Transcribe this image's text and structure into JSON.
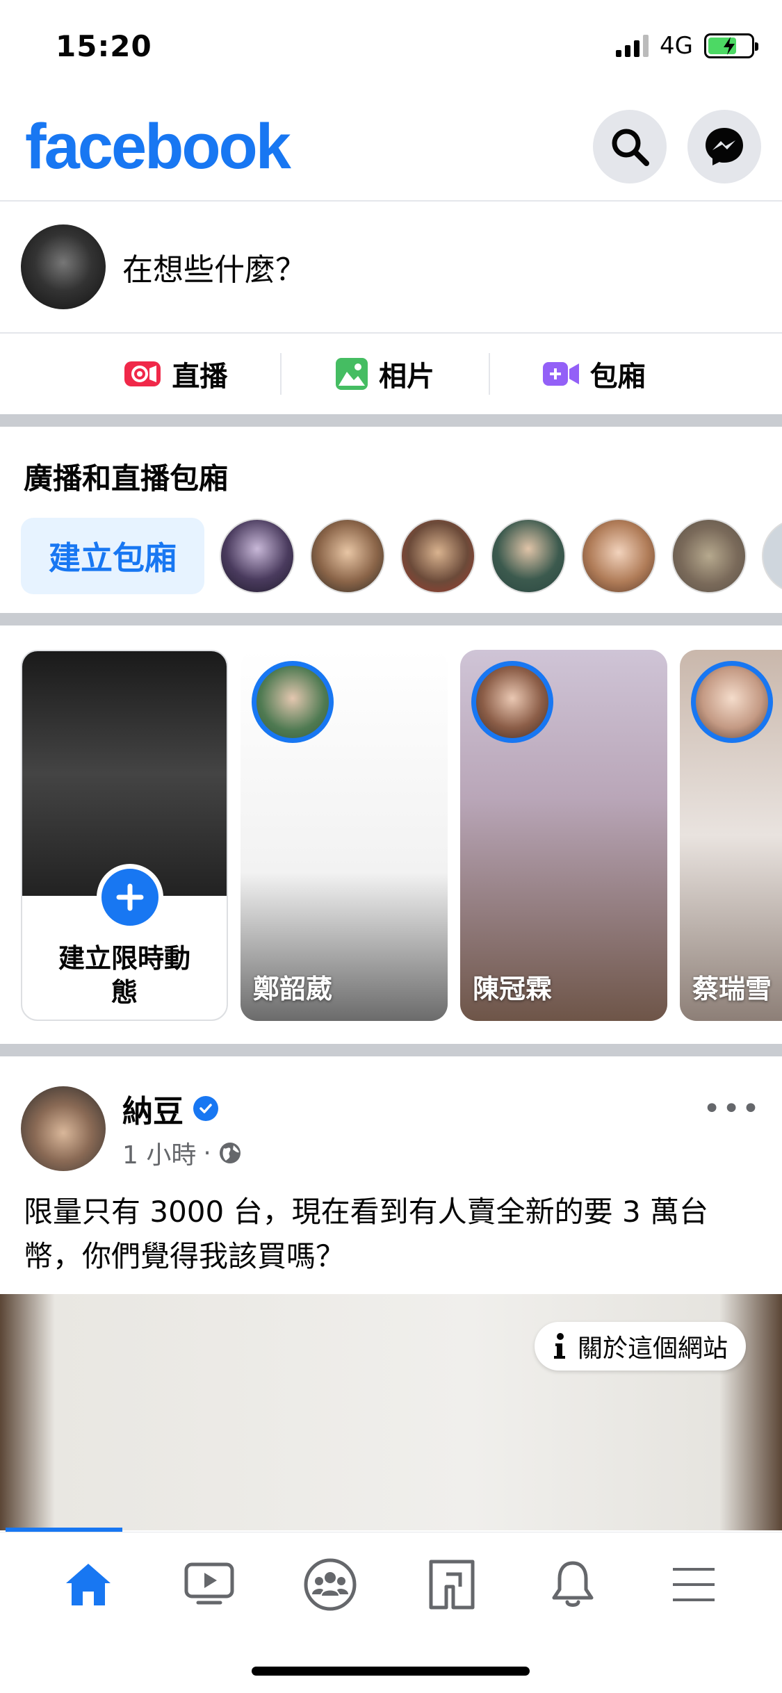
{
  "status_bar": {
    "time": "15:20",
    "network": "4G"
  },
  "header": {
    "logo": "facebook"
  },
  "composer": {
    "placeholder": "在想些什麼？"
  },
  "actions": [
    {
      "label": "直播",
      "icon": "live-video-icon",
      "color": "#f02849"
    },
    {
      "label": "相片",
      "icon": "photo-icon",
      "color": "#45bd62"
    },
    {
      "label": "包廂",
      "icon": "room-video-icon",
      "color": "#9360f7"
    }
  ],
  "rooms": {
    "title": "廣播和直播包廂",
    "create_label": "建立包廂"
  },
  "stories": {
    "create_label": "建立限時動態",
    "items": [
      {
        "name": "鄭韶葳"
      },
      {
        "name": "陳冠霖"
      },
      {
        "name": "蔡瑞雪"
      }
    ]
  },
  "post": {
    "author": "納豆",
    "time": "1 小時",
    "separator": "·",
    "more": "•••",
    "text": "限量只有 3000 台，現在看到有人賣全新的要 3 萬台幣，你們覺得我該買嗎？",
    "info_chip": "關於這個網站"
  },
  "colors": {
    "brand": "#1877f2",
    "muted": "#65676b"
  }
}
